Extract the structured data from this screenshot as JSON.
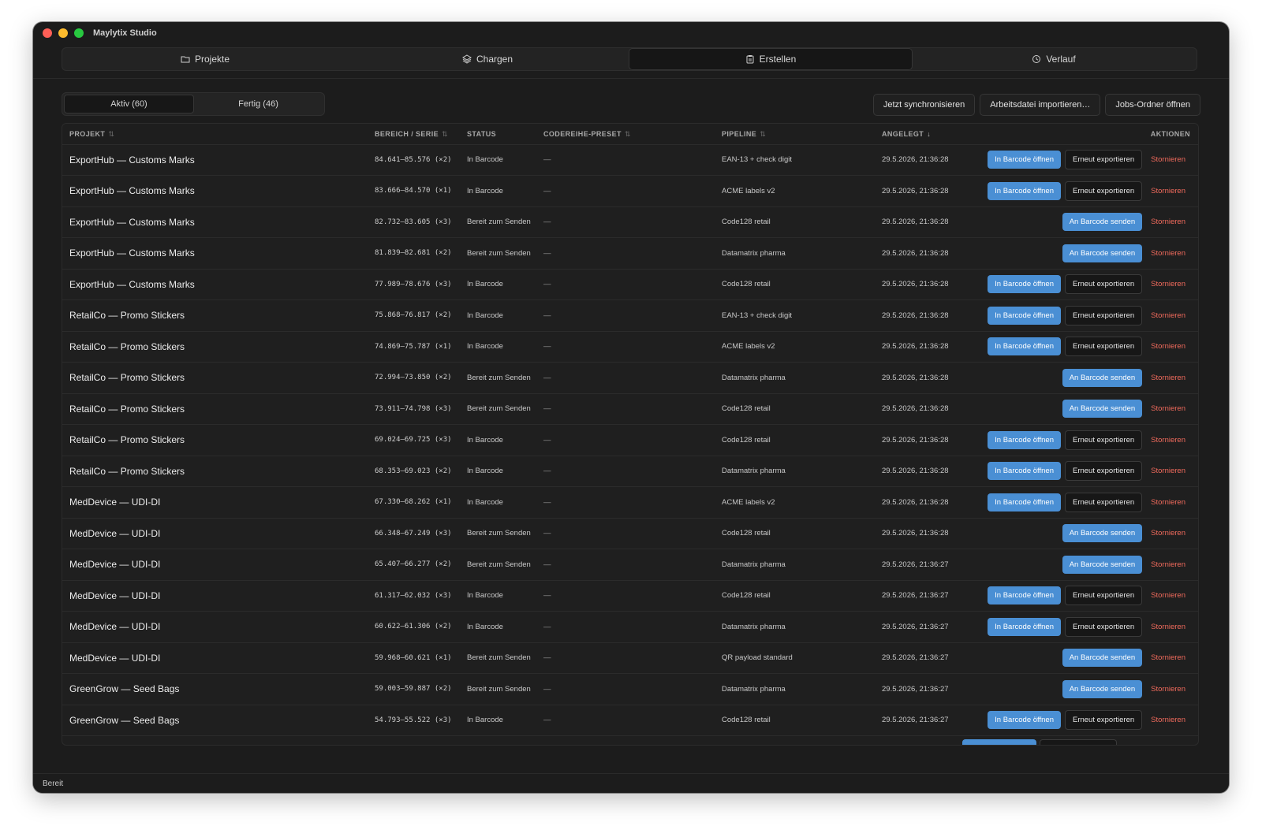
{
  "window": {
    "title": "Maylytix Studio"
  },
  "nav": {
    "tabs": [
      {
        "label": "Projekte",
        "icon": "folder-icon"
      },
      {
        "label": "Chargen",
        "icon": "layers-icon"
      },
      {
        "label": "Erstellen",
        "icon": "clipboard-icon"
      },
      {
        "label": "Verlauf",
        "icon": "history-icon"
      }
    ],
    "active": "Erstellen"
  },
  "filter": {
    "active_label": "Aktiv (60)",
    "done_label": "Fertig (46)"
  },
  "toolbar": {
    "sync_label": "Jetzt synchronisieren",
    "import_label": "Arbeitsdatei importieren…",
    "open_jobs_label": "Jobs-Ordner öffnen"
  },
  "table": {
    "headers": {
      "project": "PROJEKT",
      "range": "BEREICH / SERIE",
      "status": "STATUS",
      "preset": "CODEREIHE-PRESET",
      "pipeline": "PIPELINE",
      "created": "ANGELEGT",
      "actions": "AKTIONEN"
    },
    "sort_glyph": "⇅",
    "sort_active_glyph": "↓",
    "action_labels": {
      "open": "In Barcode öffnen",
      "reexport": "Erneut exportieren",
      "send": "An Barcode senden",
      "cancel": "Stornieren"
    },
    "rows": [
      {
        "project": "ExportHub — Customs Marks",
        "range": "84.641–85.576 (×2)",
        "status": "In Barcode",
        "preset": "—",
        "pipeline": "EAN-13 + check digit",
        "created": "29.5.2026, 21:36:28",
        "mode": "open"
      },
      {
        "project": "ExportHub — Customs Marks",
        "range": "83.666–84.570 (×1)",
        "status": "In Barcode",
        "preset": "—",
        "pipeline": "ACME labels v2",
        "created": "29.5.2026, 21:36:28",
        "mode": "open"
      },
      {
        "project": "ExportHub — Customs Marks",
        "range": "82.732–83.605 (×3)",
        "status": "Bereit zum Senden",
        "preset": "—",
        "pipeline": "Code128 retail",
        "created": "29.5.2026, 21:36:28",
        "mode": "send"
      },
      {
        "project": "ExportHub — Customs Marks",
        "range": "81.839–82.681 (×2)",
        "status": "Bereit zum Senden",
        "preset": "—",
        "pipeline": "Datamatrix pharma",
        "created": "29.5.2026, 21:36:28",
        "mode": "send"
      },
      {
        "project": "ExportHub — Customs Marks",
        "range": "77.989–78.676 (×3)",
        "status": "In Barcode",
        "preset": "—",
        "pipeline": "Code128 retail",
        "created": "29.5.2026, 21:36:28",
        "mode": "open"
      },
      {
        "project": "RetailCo — Promo Stickers",
        "range": "75.868–76.817 (×2)",
        "status": "In Barcode",
        "preset": "—",
        "pipeline": "EAN-13 + check digit",
        "created": "29.5.2026, 21:36:28",
        "mode": "open"
      },
      {
        "project": "RetailCo — Promo Stickers",
        "range": "74.869–75.787 (×1)",
        "status": "In Barcode",
        "preset": "—",
        "pipeline": "ACME labels v2",
        "created": "29.5.2026, 21:36:28",
        "mode": "open"
      },
      {
        "project": "RetailCo — Promo Stickers",
        "range": "72.994–73.850 (×2)",
        "status": "Bereit zum Senden",
        "preset": "—",
        "pipeline": "Datamatrix pharma",
        "created": "29.5.2026, 21:36:28",
        "mode": "send"
      },
      {
        "project": "RetailCo — Promo Stickers",
        "range": "73.911–74.798 (×3)",
        "status": "Bereit zum Senden",
        "preset": "—",
        "pipeline": "Code128 retail",
        "created": "29.5.2026, 21:36:28",
        "mode": "send"
      },
      {
        "project": "RetailCo — Promo Stickers",
        "range": "69.024–69.725 (×3)",
        "status": "In Barcode",
        "preset": "—",
        "pipeline": "Code128 retail",
        "created": "29.5.2026, 21:36:28",
        "mode": "open"
      },
      {
        "project": "RetailCo — Promo Stickers",
        "range": "68.353–69.023 (×2)",
        "status": "In Barcode",
        "preset": "—",
        "pipeline": "Datamatrix pharma",
        "created": "29.5.2026, 21:36:28",
        "mode": "open"
      },
      {
        "project": "MedDevice — UDI-DI",
        "range": "67.330–68.262 (×1)",
        "status": "In Barcode",
        "preset": "—",
        "pipeline": "ACME labels v2",
        "created": "29.5.2026, 21:36:28",
        "mode": "open"
      },
      {
        "project": "MedDevice — UDI-DI",
        "range": "66.348–67.249 (×3)",
        "status": "Bereit zum Senden",
        "preset": "—",
        "pipeline": "Code128 retail",
        "created": "29.5.2026, 21:36:28",
        "mode": "send"
      },
      {
        "project": "MedDevice — UDI-DI",
        "range": "65.407–66.277 (×2)",
        "status": "Bereit zum Senden",
        "preset": "—",
        "pipeline": "Datamatrix pharma",
        "created": "29.5.2026, 21:36:27",
        "mode": "send"
      },
      {
        "project": "MedDevice — UDI-DI",
        "range": "61.317–62.032 (×3)",
        "status": "In Barcode",
        "preset": "—",
        "pipeline": "Code128 retail",
        "created": "29.5.2026, 21:36:27",
        "mode": "open"
      },
      {
        "project": "MedDevice — UDI-DI",
        "range": "60.622–61.306 (×2)",
        "status": "In Barcode",
        "preset": "—",
        "pipeline": "Datamatrix pharma",
        "created": "29.5.2026, 21:36:27",
        "mode": "open"
      },
      {
        "project": "MedDevice — UDI-DI",
        "range": "59.968–60.621 (×1)",
        "status": "Bereit zum Senden",
        "preset": "—",
        "pipeline": "QR payload standard",
        "created": "29.5.2026, 21:36:27",
        "mode": "send"
      },
      {
        "project": "GreenGrow — Seed Bags",
        "range": "59.003–59.887 (×2)",
        "status": "Bereit zum Senden",
        "preset": "—",
        "pipeline": "Datamatrix pharma",
        "created": "29.5.2026, 21:36:27",
        "mode": "send"
      },
      {
        "project": "GreenGrow — Seed Bags",
        "range": "54.793–55.522 (×3)",
        "status": "In Barcode",
        "preset": "—",
        "pipeline": "Code128 retail",
        "created": "29.5.2026, 21:36:27",
        "mode": "open"
      }
    ]
  },
  "statusbar": {
    "text": "Bereit"
  },
  "colors": {
    "accent": "#4a8fd4",
    "danger": "#f06a5c",
    "window_bg": "#1c1c1c"
  }
}
